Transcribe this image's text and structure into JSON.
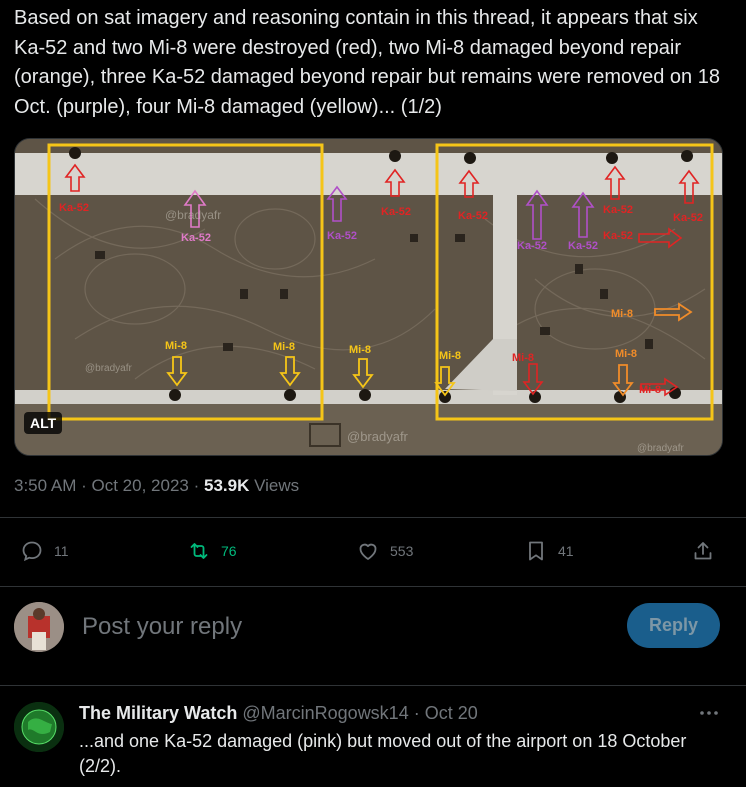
{
  "tweet": {
    "text": "Based on sat imagery and reasoning contain in this thread, it appears that six Ka-52 and two Mi-8 were destroyed (red), two Mi-8 damaged beyond repair (orange), three Ka-52 damaged beyond repair but remains were removed on 18 Oct. (purple), four Mi-8 damaged (yellow)... (1/2)",
    "media": {
      "alt_badge": "ALT",
      "watermark": "@bradyafr",
      "labels": {
        "ka52": "Ka-52",
        "mi8": "Mi-8"
      }
    },
    "time": "3:50 AM",
    "date": "Oct 20, 2023",
    "dot": "·",
    "views_count": "53.9K",
    "views_label": "Views"
  },
  "actions": {
    "replies": "11",
    "retweets": "76",
    "likes": "553",
    "bookmarks": "41"
  },
  "compose": {
    "placeholder": "Post your reply",
    "button_label": "Reply"
  },
  "reply": {
    "author_name": "The Military Watch",
    "handle": "@MarcinRogowsk14",
    "sep": "·",
    "date": "Oct 20",
    "text": "...and one Ka-52 damaged (pink) but moved out of the airport on 18 October (2/2)."
  },
  "colors": {
    "background": "#000000",
    "text": "#e7e9ea",
    "muted": "#71767b",
    "retweet_green": "#00ba7c",
    "reply_button_bg": "#1a5e8c",
    "highlight_yellow": "#f5c518",
    "destroyed_red": "#e02424",
    "orange": "#f08c2a",
    "purple": "#b050c8",
    "pink": "#e07ac8"
  },
  "icons": {
    "reply": "comment-bubble-icon",
    "retweet": "retweet-icon",
    "like": "heart-icon",
    "bookmark": "bookmark-icon",
    "share": "share-upload-icon",
    "more": "more-dots-icon"
  }
}
